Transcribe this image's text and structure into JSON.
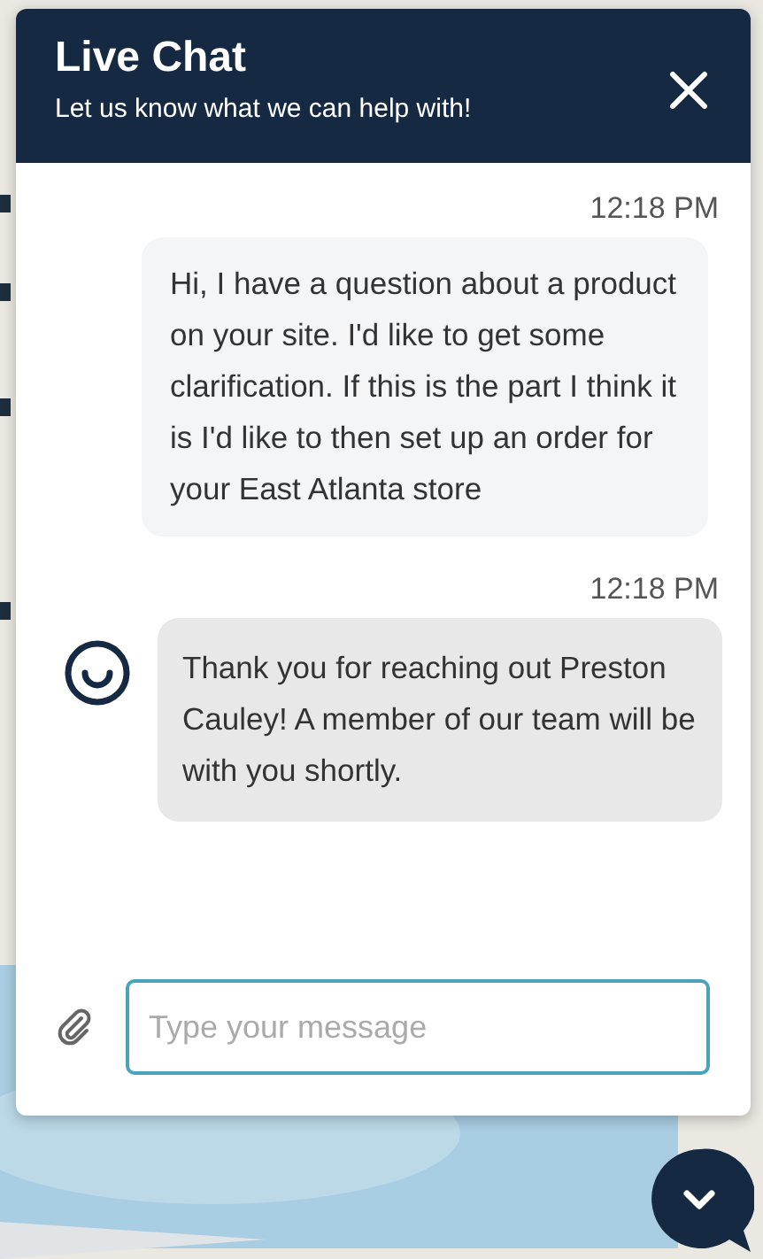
{
  "chat": {
    "title": "Live Chat",
    "subtitle": "Let us know what we can help with!"
  },
  "messages": [
    {
      "kind": "visitor",
      "time": "12:18 PM",
      "text": "Hi, I have a question about a product on your site. I'd like to get some clarification. If this is the part I think it is I'd like to then set up an order for your East Atlanta store"
    },
    {
      "kind": "agent",
      "time": "12:18 PM",
      "text": "Thank you for reaching out Preston Cauley! A member of our team will be with you shortly."
    }
  ],
  "composer": {
    "placeholder": "Type your message"
  }
}
